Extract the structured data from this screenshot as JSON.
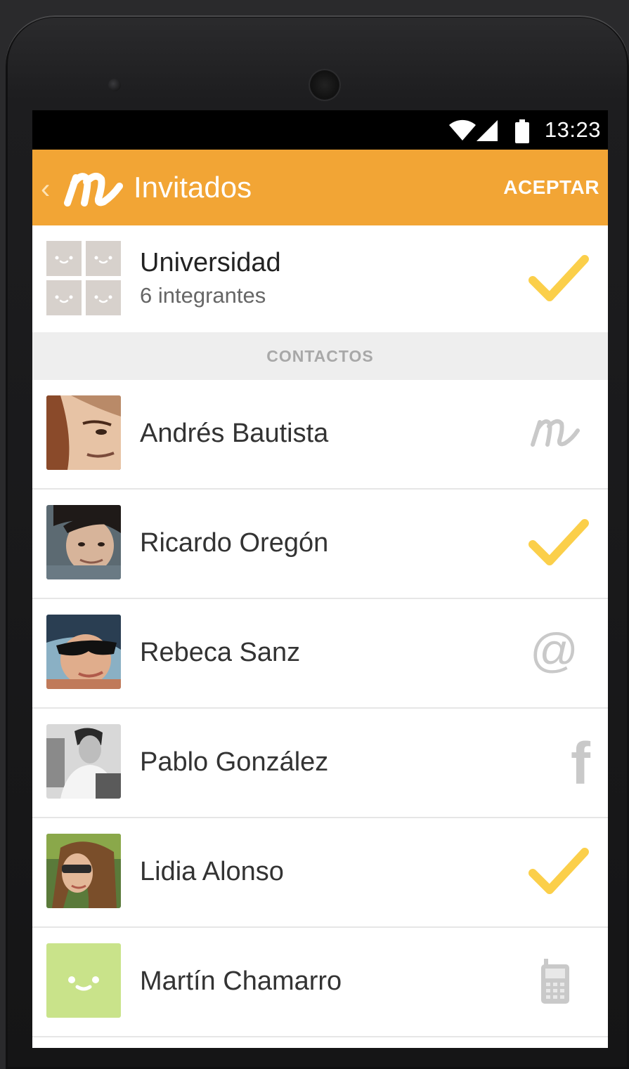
{
  "status_bar": {
    "time": "13:23"
  },
  "action_bar": {
    "title": "Invitados",
    "accept_label": "ACEPTAR",
    "accent": "#f2a535"
  },
  "group": {
    "name": "Universidad",
    "members": "6 integrantes"
  },
  "section_header": "CONTACTOS",
  "contacts": [
    {
      "name": "Andrés Bautista",
      "status_icon": "m-logo-icon"
    },
    {
      "name": "Ricardo Oregón",
      "status_icon": "check-icon"
    },
    {
      "name": "Rebeca Sanz",
      "status_icon": "at-icon"
    },
    {
      "name": "Pablo González",
      "status_icon": "facebook-icon"
    },
    {
      "name": "Lidia Alonso",
      "status_icon": "check-icon"
    },
    {
      "name": "Martín Chamarro",
      "status_icon": "phone-icon"
    }
  ],
  "at_symbol": "@",
  "facebook_glyph": "f"
}
